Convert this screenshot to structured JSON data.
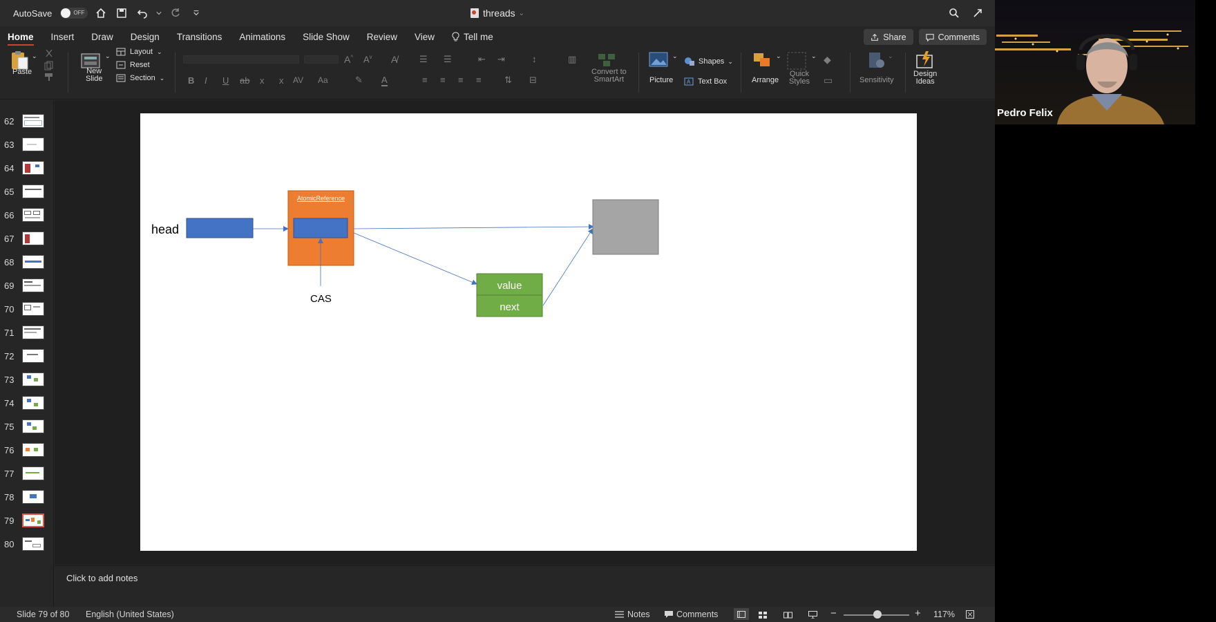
{
  "titlebar": {
    "autosave_label": "AutoSave",
    "autosave_state": "OFF",
    "document_title": "threads"
  },
  "tabs": {
    "items": [
      "Home",
      "Insert",
      "Draw",
      "Design",
      "Transitions",
      "Animations",
      "Slide Show",
      "Review",
      "View"
    ],
    "tell_me": "Tell me",
    "share_label": "Share",
    "comments_label": "Comments"
  },
  "ribbon": {
    "paste": "Paste",
    "new_slide": [
      "New",
      "Slide"
    ],
    "layout": "Layout",
    "reset": "Reset",
    "section": "Section",
    "convert_smartart": [
      "Convert to",
      "SmartArt"
    ],
    "picture": "Picture",
    "shapes": "Shapes",
    "text_box": "Text Box",
    "arrange": "Arrange",
    "quick_styles": [
      "Quick",
      "Styles"
    ],
    "sensitivity": "Sensitivity",
    "design_ideas": [
      "Design",
      "Ideas"
    ]
  },
  "thumbnails": {
    "numbers": [
      "62",
      "63",
      "64",
      "65",
      "66",
      "67",
      "68",
      "69",
      "70",
      "71",
      "72",
      "73",
      "74",
      "75",
      "76",
      "77",
      "78",
      "79",
      "80"
    ],
    "selected": "79"
  },
  "slide": {
    "head_label": "head",
    "atomic_reference_label": "AtomicReference",
    "cas_label": "CAS",
    "node_value_label": "value",
    "node_next_label": "next",
    "colors": {
      "blue": "#4472c4",
      "orange": "#ed7d31",
      "green": "#70ad47",
      "gray": "#a5a5a5",
      "arrow": "#4472c4"
    }
  },
  "notes": {
    "placeholder": "Click to add notes"
  },
  "status": {
    "slide_position": "Slide 79 of 80",
    "language": "English (United States)",
    "notes": "Notes",
    "comments": "Comments",
    "zoom": "117%"
  },
  "video": {
    "speaker_name": "Pedro Felix"
  }
}
